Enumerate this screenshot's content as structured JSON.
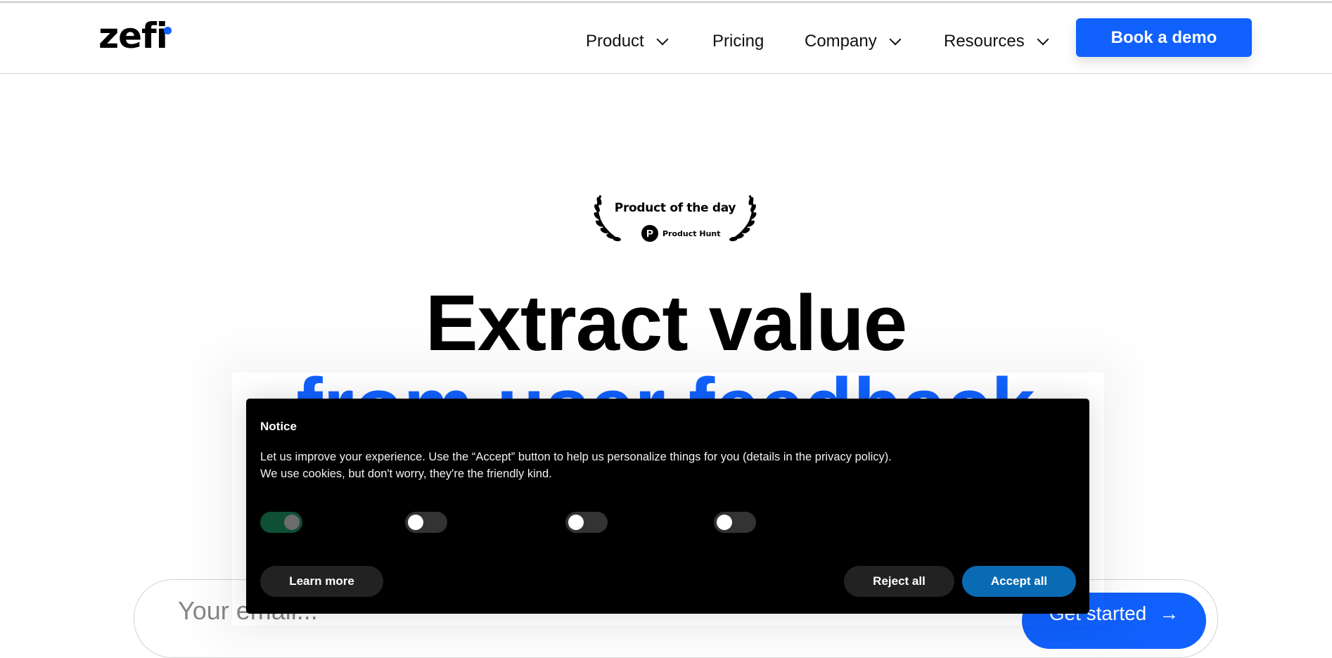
{
  "header": {
    "logo": "zefi",
    "nav": [
      {
        "label": "Product",
        "has_dropdown": true
      },
      {
        "label": "Pricing",
        "has_dropdown": false
      },
      {
        "label": "Company",
        "has_dropdown": true
      },
      {
        "label": "Resources",
        "has_dropdown": true
      }
    ],
    "cta_label": "Book a demo"
  },
  "hero": {
    "badge": {
      "title": "Product of the day",
      "source": "Product Hunt",
      "source_icon": "P"
    },
    "headline_line1": "Extract value",
    "headline_line2": "from user feedback",
    "email_placeholder": "Your email...",
    "submit_label": "Get started",
    "submit_icon": "→"
  },
  "cookie_notice": {
    "title": "Notice",
    "body_line1": "Let us improve your experience. Use the “Accept” button to help us personalize things for you (details in the privacy policy).",
    "body_line2": "We use cookies, but don't worry, they're the friendly kind.",
    "toggles": [
      {
        "state": "on",
        "disabled": true
      },
      {
        "state": "off"
      },
      {
        "state": "off"
      },
      {
        "state": "off"
      }
    ],
    "learn_more_label": "Learn more",
    "reject_label": "Reject all",
    "accept_label": "Accept all"
  },
  "colors": {
    "brand_blue": "#1161fe",
    "accept_blue": "#0a6bb5",
    "toggle_on": "#0f4f35",
    "modal_bg": "#000000"
  }
}
